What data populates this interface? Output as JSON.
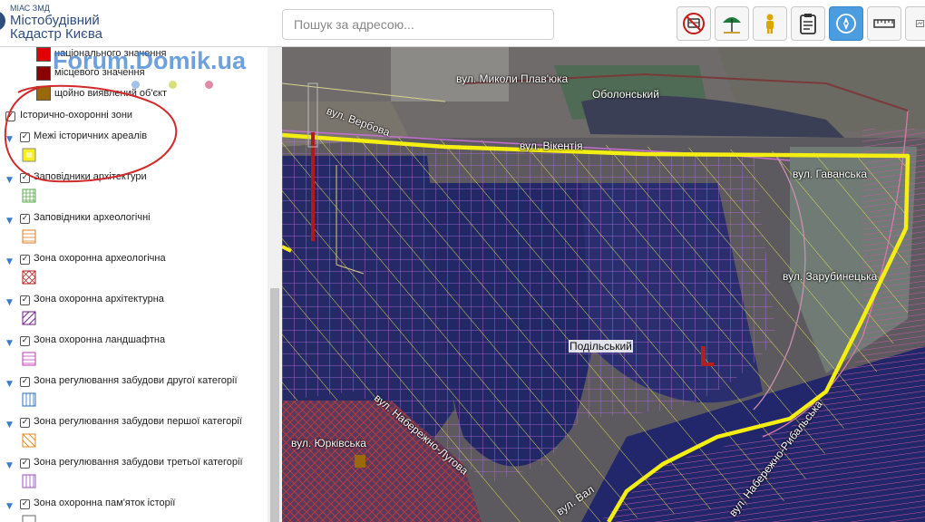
{
  "header": {
    "brand_small": "МІАС ЗМД",
    "brand_line1": "Містобудівний",
    "brand_line2": "Кадастр Києва",
    "search_placeholder": "Пошук за адресою...",
    "toolbar": [
      {
        "name": "no-bus-icon",
        "active": false
      },
      {
        "name": "beach-umbrella-icon",
        "active": false
      },
      {
        "name": "person-icon",
        "active": false
      },
      {
        "name": "clipboard-icon",
        "active": false
      },
      {
        "name": "compass-icon",
        "active": true
      },
      {
        "name": "ruler-icon",
        "active": false
      },
      {
        "name": "map-frame-icon",
        "active": false
      }
    ]
  },
  "watermark": "Forum.Domik.ua",
  "legend_top": [
    {
      "label": "національного значення",
      "color": "#e00000"
    },
    {
      "label": "місцевого значення",
      "color": "#8a0000"
    },
    {
      "label": "щойно виявлений об'єкт",
      "color": "#9a6a0a"
    }
  ],
  "group": {
    "label": "Історично-охоронні зони",
    "checked": true
  },
  "layers": [
    {
      "label": "Межі історичних ареалів",
      "symbol": "yellow-fill"
    },
    {
      "label": "Заповідники архітектури",
      "symbol": "green-grid"
    },
    {
      "label": "Заповідники археологічні",
      "symbol": "orange-grid"
    },
    {
      "label": "Зона охоронна археологічна",
      "symbol": "red-cross"
    },
    {
      "label": "Зона охоронна архітектурна",
      "symbol": "purple-diag"
    },
    {
      "label": "Зона охоронна ландшафтна",
      "symbol": "magenta-hlines"
    },
    {
      "label": "Зона регулювання забудови другої категорії",
      "symbol": "blue-vlines"
    },
    {
      "label": "Зона регулювання забудови першої категорії",
      "symbol": "orange-diag"
    },
    {
      "label": "Зона регулювання забудови третьої категорії",
      "symbol": "purple-vlines"
    },
    {
      "label": "Зона охоронна пам'яток історії",
      "symbol": "empty"
    }
  ],
  "map": {
    "streets": [
      {
        "label": "вул. Миколи Плав'юка"
      },
      {
        "label": "Оболонський"
      },
      {
        "label": "вул. Вербова"
      },
      {
        "label": "вул. Вікентія"
      },
      {
        "label": "вул. Гаванська"
      },
      {
        "label": "вул. Зарубинецька"
      },
      {
        "label": "вул. Набережно-Луговa"
      },
      {
        "label": "вул. Юрківська"
      },
      {
        "label": "вул. Вал"
      },
      {
        "label": "вул. Набережно-Рибальська"
      }
    ],
    "district": "Подільський"
  }
}
